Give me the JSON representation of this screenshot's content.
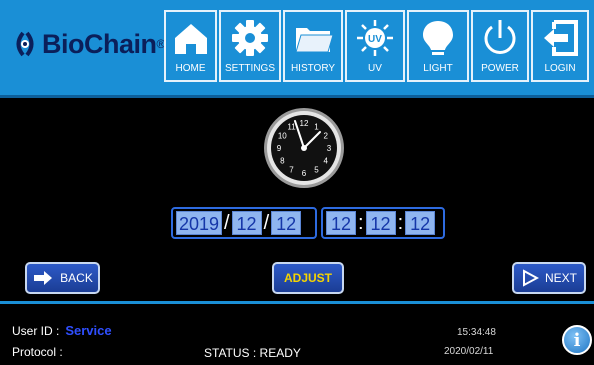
{
  "brand": {
    "name": "BioChain",
    "reg": "®"
  },
  "nav": {
    "home": "HOME",
    "settings": "SETTINGS",
    "history": "HISTORY",
    "uv": "UV",
    "uv_badge": "UV",
    "light": "LIGHT",
    "power": "POWER",
    "login": "LOGIN"
  },
  "clock": {
    "numbers": [
      "12",
      "1",
      "2",
      "3",
      "4",
      "5",
      "6",
      "7",
      "8",
      "9",
      "10",
      "11"
    ]
  },
  "date": {
    "year": "2019",
    "month": "12",
    "day": "12",
    "sep": "/"
  },
  "time": {
    "hour": "12",
    "minute": "12",
    "second": "12",
    "sep": ":"
  },
  "buttons": {
    "back": "BACK",
    "adjust": "ADJUST",
    "next": "NEXT"
  },
  "status": {
    "user_label": "User ID :",
    "user_value": "Service",
    "protocol_label": "Protocol :",
    "status_text": "STATUS : READY",
    "clock_time": "15:34:48",
    "clock_date": "2020/02/11",
    "info_glyph": "i"
  },
  "colors": {
    "nav_bg": "#1a8fd6",
    "field_bg": "#8fb5ef",
    "field_text": "#1536a8",
    "adjust_text": "#f5d400",
    "user_value": "#2f4fff"
  },
  "icons": [
    "biochain-logo-icon",
    "home-icon",
    "gear-icon",
    "folder-icon",
    "uv-sun-icon",
    "lightbulb-icon",
    "power-icon",
    "login-icon",
    "back-arrow-icon",
    "next-arrow-icon",
    "info-icon"
  ]
}
